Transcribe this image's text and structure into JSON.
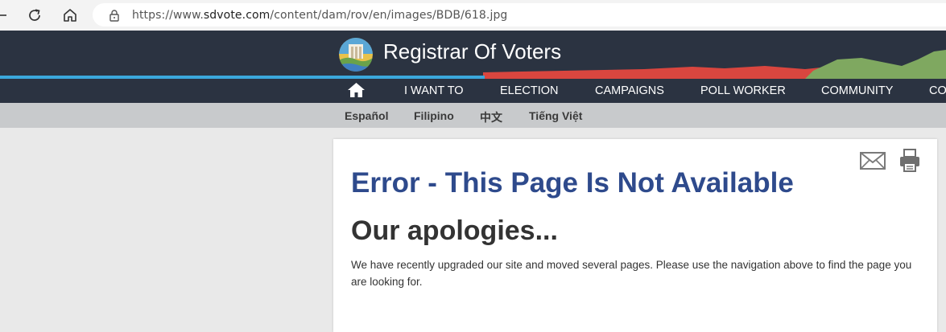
{
  "browser": {
    "url_prefix": "https://www.",
    "url_host": "sdvote.com",
    "url_path": "/content/dam/rov/en/images/BDB/618.jpg"
  },
  "header": {
    "site_title": "Registrar Of Voters",
    "colors": {
      "background": "#2b3341",
      "stripe": "#3ba8dc",
      "red_hills": "#d9463f",
      "green_hills": "#7fa860"
    }
  },
  "nav": {
    "items": [
      "I WANT TO",
      "ELECTION",
      "CAMPAIGNS",
      "POLL WORKER",
      "COMMUNITY",
      "CO"
    ]
  },
  "languages": [
    "Español",
    "Filipino",
    "中文",
    "Tiếng Việt"
  ],
  "content": {
    "title": "Error - This Page Is Not Available",
    "subtitle": "Our apologies...",
    "message": "We have recently upgraded our site and moved several pages. Please use the navigation above to find the page you are looking for."
  },
  "icons": {
    "back": "back-arrow-icon",
    "reload": "reload-icon",
    "home": "home-icon",
    "lock": "lock-icon",
    "mail": "mail-icon",
    "print": "print-icon"
  }
}
